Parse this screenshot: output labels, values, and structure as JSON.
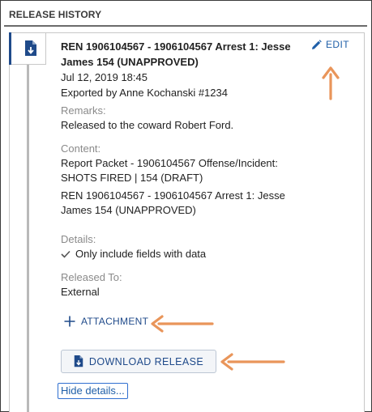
{
  "section": {
    "title": "RELEASE HISTORY"
  },
  "release": {
    "title_line1": "REN 1906104567 - 1906104567 Arrest 1: Jesse",
    "title_line2": "James 154 (UNAPPROVED)",
    "date": "Jul 12, 2019 18:45",
    "exported_by": "Exported by Anne Kochanski #1234",
    "remarks_label": "Remarks:",
    "remarks_value": "Released to the coward Robert Ford.",
    "content_label": "Content:",
    "content_items": [
      {
        "line1": "Report Packet - 1906104567 Offense/Incident:",
        "line2": "SHOTS FIRED | 154 (DRAFT)"
      },
      {
        "line1": "REN 1906104567 - 1906104567 Arrest 1: Jesse",
        "line2": "James 154 (UNAPPROVED)"
      }
    ],
    "details_label": "Details:",
    "details_value": "Only include fields with data",
    "released_to_label": "Released To:",
    "released_to_value": "External"
  },
  "actions": {
    "edit_label": "EDIT",
    "attachment_label": "ATTACHMENT",
    "download_label": "DOWNLOAD RELEASE",
    "hide_details_label": "Hide details..."
  },
  "icons": {
    "document": "document-download-icon",
    "edit": "pencil-icon",
    "attachment": "plus-icon",
    "download": "document-download-icon",
    "check": "checkmark-icon"
  },
  "colors": {
    "accent": "#1f4a8a",
    "link": "#1f5fa8",
    "annotation_arrow": "#e9955a"
  }
}
